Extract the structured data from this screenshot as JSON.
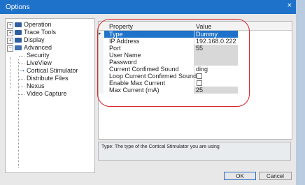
{
  "window": {
    "title": "Options",
    "close_glyph": "×"
  },
  "tree": {
    "items": [
      {
        "label": "Operation",
        "expander": "+"
      },
      {
        "label": "Trace Tools",
        "expander": "+"
      },
      {
        "label": "Display",
        "expander": "+"
      },
      {
        "label": "Advanced",
        "expander": "−"
      },
      {
        "label": "Security"
      },
      {
        "label": "LiveView"
      },
      {
        "label": "Cortical Stimulator",
        "selected": true
      },
      {
        "label": "Distribute Files"
      },
      {
        "label": "Nexus"
      },
      {
        "label": "Video Capture"
      }
    ],
    "selected_marker": "→"
  },
  "grid": {
    "headers": {
      "property": "Property",
      "value": "Value"
    },
    "row_marker": "▸",
    "rows": [
      {
        "property": "Type",
        "value": "Dummy",
        "kind": "text",
        "selected": true
      },
      {
        "property": "IP Address",
        "value": "192.168.0.222",
        "kind": "text"
      },
      {
        "property": "Port",
        "value": "55",
        "kind": "text"
      },
      {
        "property": "User Name",
        "value": "",
        "kind": "text"
      },
      {
        "property": "Password",
        "value": "",
        "kind": "text"
      },
      {
        "property": "Current Confimed Sound",
        "value": "ding",
        "kind": "text"
      },
      {
        "property": "Loop Current Confirmed Sound",
        "value": "",
        "kind": "checkbox",
        "checked": false
      },
      {
        "property": "Enable Max Current",
        "value": "",
        "kind": "checkbox",
        "checked": false
      },
      {
        "property": "Max Current (mA)",
        "value": "25",
        "kind": "text"
      }
    ]
  },
  "description": {
    "text": "Type: The type of the Cortical Stimulator you are using"
  },
  "buttons": {
    "ok": "OK",
    "cancel": "Cancel"
  },
  "colors": {
    "titlebar": "#1e72c9",
    "selection": "#1e72c9",
    "highlight": "#d8242d",
    "folder": "#2f5f9e"
  }
}
